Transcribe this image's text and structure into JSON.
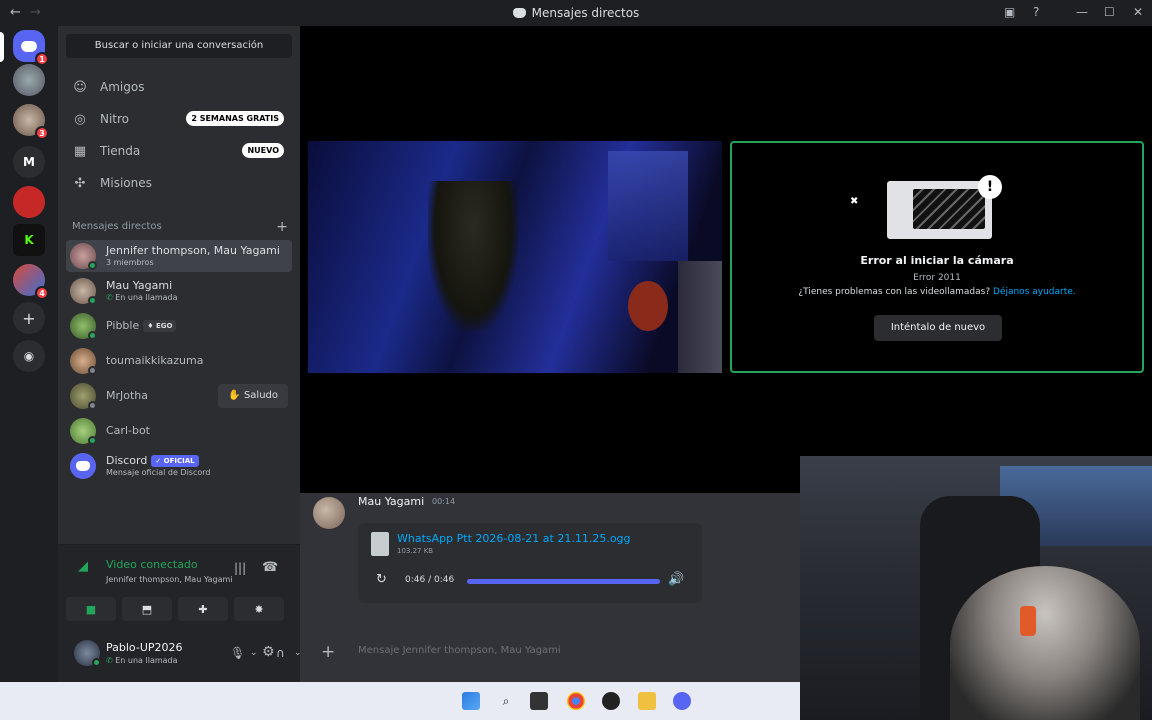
{
  "window": {
    "title": "Mensajes directos",
    "back": "←",
    "forward": "→"
  },
  "guilds": {
    "home_badge": "1",
    "g1_badge": "3",
    "g2_badge": "4",
    "m_label": "M",
    "add": "+"
  },
  "sidebar": {
    "search_placeholder": "Buscar o iniciar una conversación",
    "nav": [
      {
        "label": "Amigos",
        "icon": "friends-icon"
      },
      {
        "label": "Nitro",
        "icon": "nitro-icon",
        "tag": "2 SEMANAS GRATIS"
      },
      {
        "label": "Tienda",
        "icon": "shop-icon",
        "tag": "NUEVO"
      },
      {
        "label": "Misiones",
        "icon": "quests-icon"
      }
    ],
    "dm_header": "Mensajes directos",
    "dms": [
      {
        "name": "Jennifer thompson, Mau Yagami",
        "sub": "3 miembros"
      },
      {
        "name": "Mau Yagami",
        "sub": "En una llamada"
      },
      {
        "name": "Pibble",
        "tag": "EGO"
      },
      {
        "name": "toumaikkikazuma"
      },
      {
        "name": "MrJotha",
        "action": "Saludo"
      },
      {
        "name": "Carl-bot"
      },
      {
        "name": "Discord",
        "tag": "OFICIAL",
        "sub": "Mensaje oficial de Discord"
      }
    ]
  },
  "voice": {
    "status": "Video conectado",
    "channel": "Jennifer thompson, Mau Yagami"
  },
  "user": {
    "name": "Pablo-UP2026",
    "status": "En una llamada"
  },
  "stage": {
    "error_title": "Error al iniciar la cámara",
    "error_code": "Error 2011",
    "help_text": "¿Tienes problemas con las videollamadas?",
    "help_link": "Déjanos ayudarte.",
    "retry_label": "Inténtalo de nuevo"
  },
  "chat": {
    "author": "Mau Yagami",
    "time": "00:14",
    "file_name": "WhatsApp Ptt 2026-08-21 at 21.11.25.ogg",
    "file_size": "103.27 KB",
    "player_time": "0:46 / 0:46",
    "progress": 1.0,
    "composer_placeholder": "Mensaje Jennifer thompson, Mau Yagami"
  },
  "colors": {
    "blurple": "#5865f2",
    "online": "#23a55a",
    "link": "#00a8fc",
    "danger": "#f23f43"
  }
}
